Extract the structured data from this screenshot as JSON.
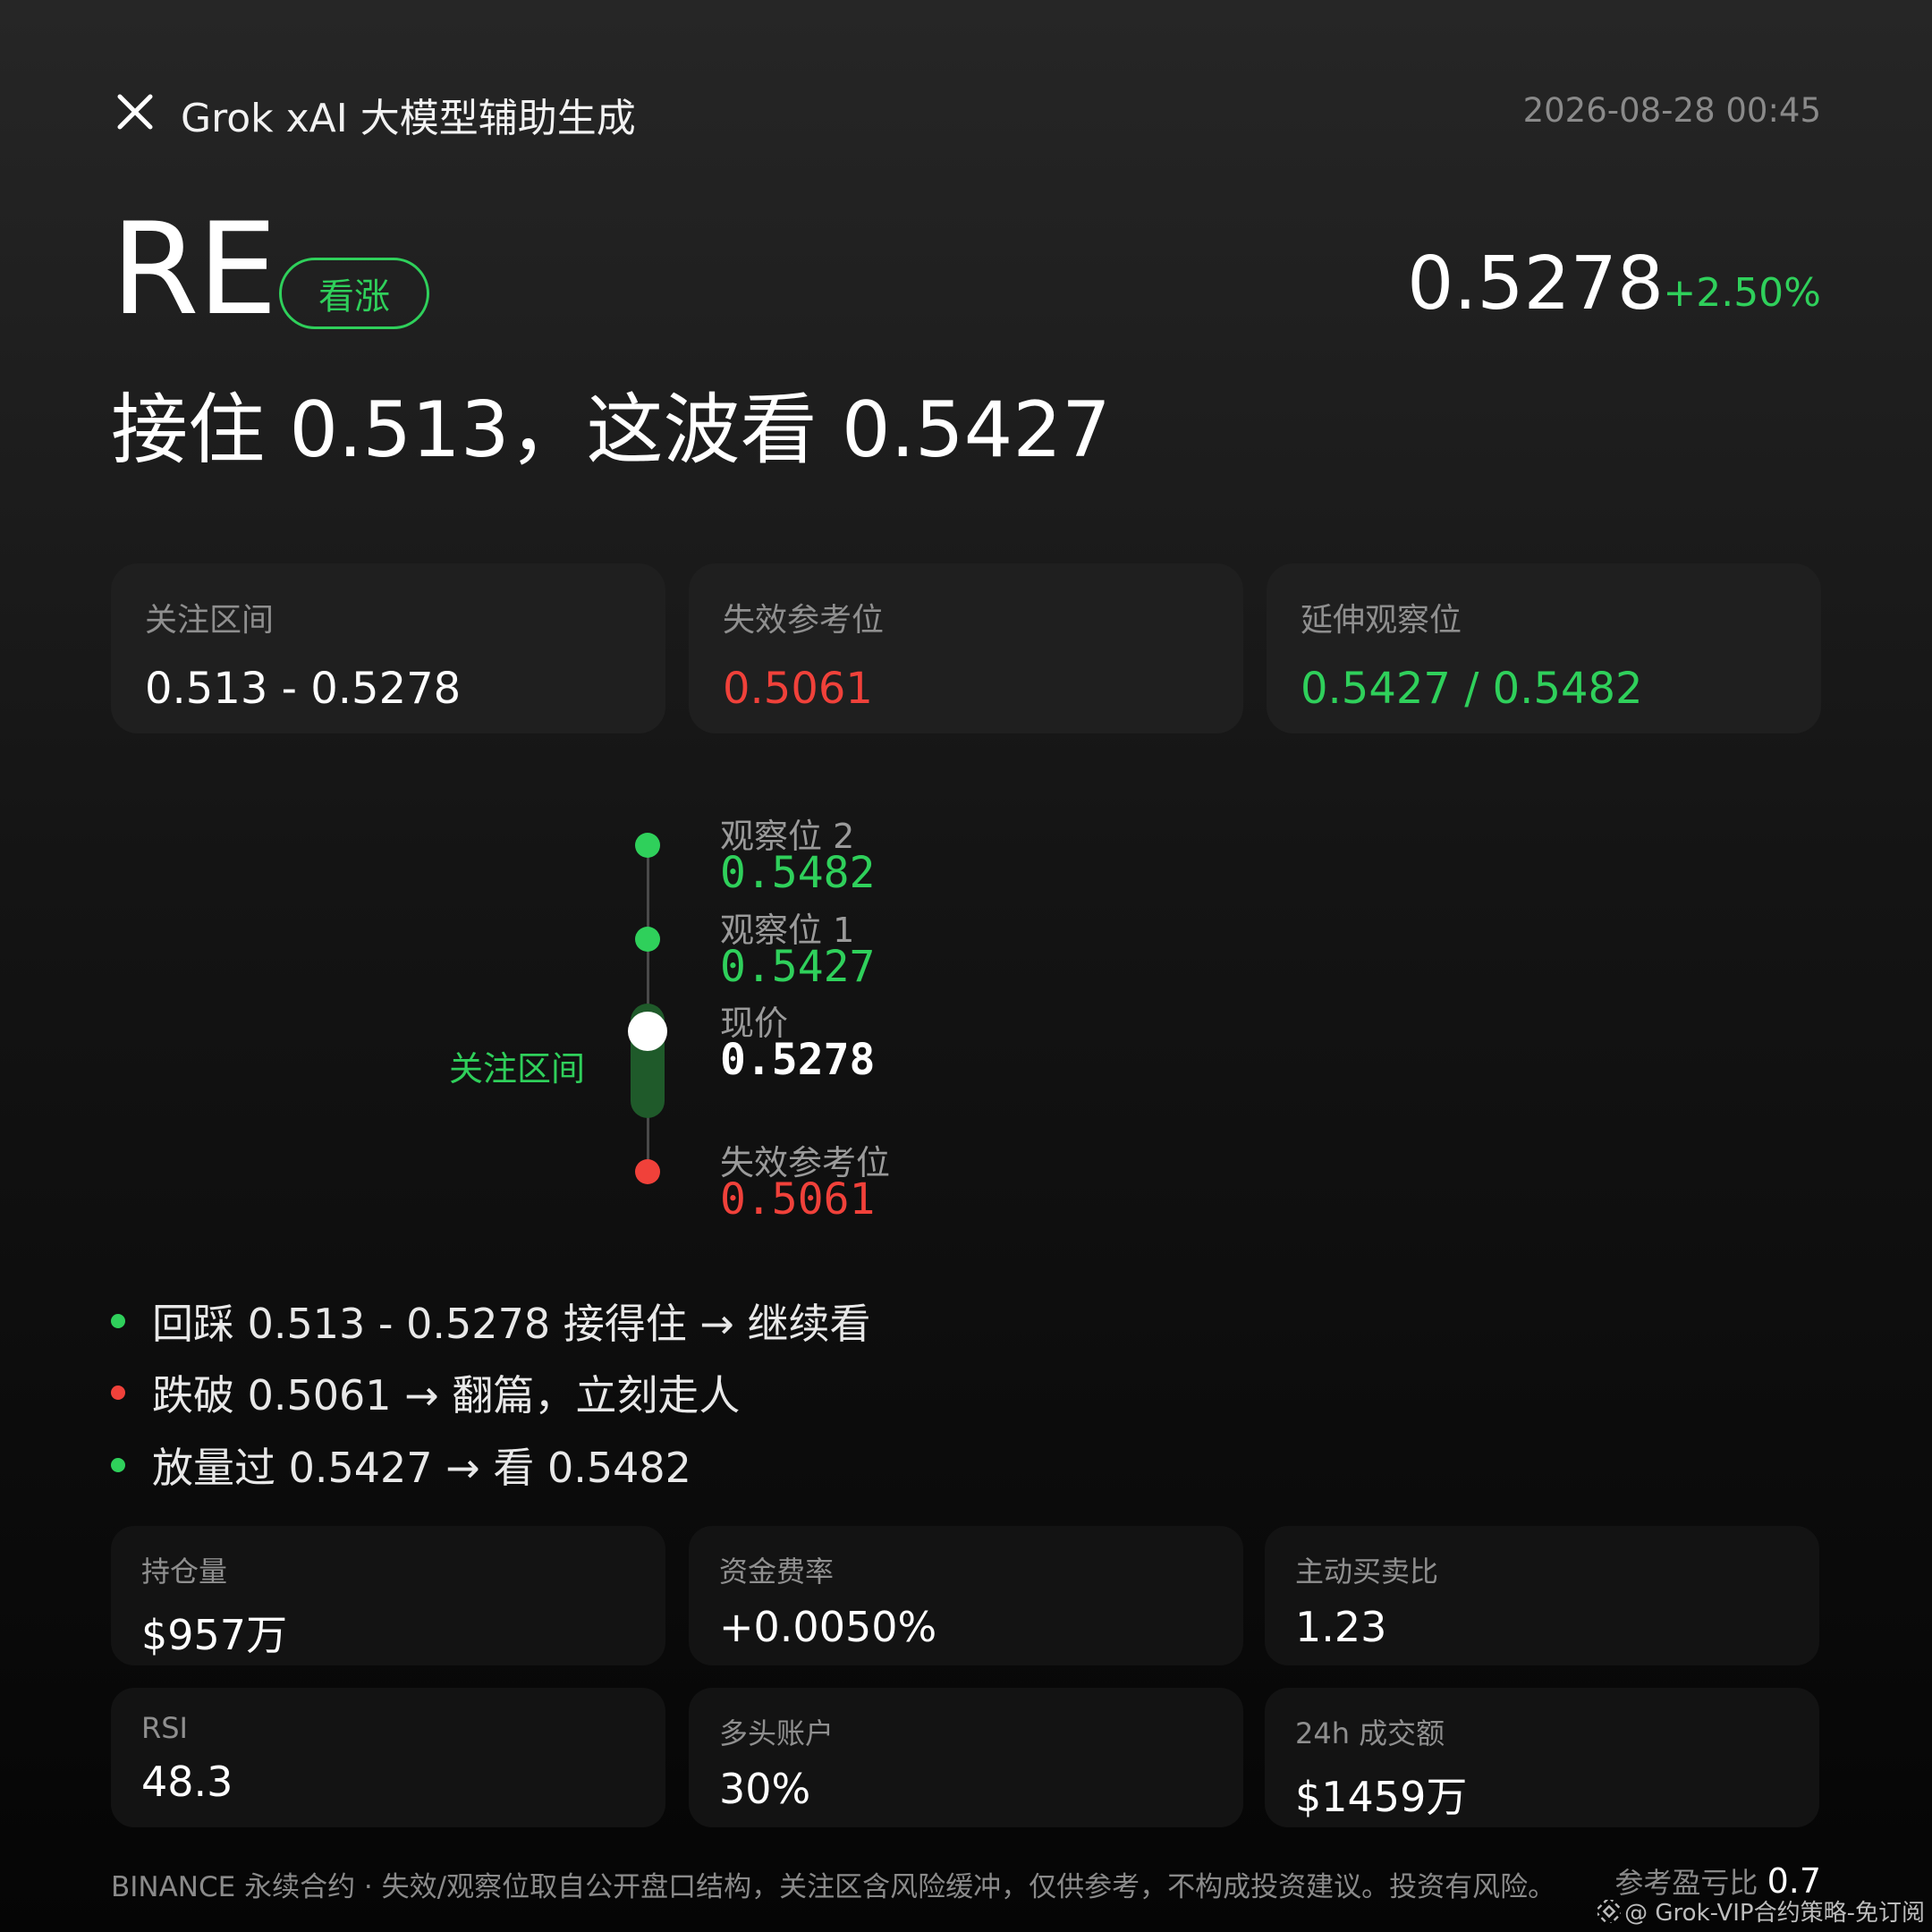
{
  "header": {
    "title": "Grok xAI 大模型辅助生成",
    "timestamp": "2026-08-28 00:45"
  },
  "symbol": "RE",
  "badge": "看涨",
  "price": "0.5278",
  "change": "+2.50%",
  "headline": "接住 0.513，这波看 0.5427",
  "cards": [
    {
      "label": "关注区间",
      "value": "0.513 - 0.5278"
    },
    {
      "label": "失效参考位",
      "value": "0.5061"
    },
    {
      "label": "延伸观察位",
      "value": "0.5427 / 0.5482"
    }
  ],
  "ladder": {
    "zone_label": "关注区间",
    "levels": [
      {
        "label": "观察位 2",
        "value": "0.5482"
      },
      {
        "label": "观察位 1",
        "value": "0.5427"
      },
      {
        "label": "现价",
        "value": "0.5278"
      },
      {
        "label": "失效参考位",
        "value": "0.5061"
      }
    ]
  },
  "bullets": [
    {
      "text": "回踩 0.513 - 0.5278 接得住 → 继续看"
    },
    {
      "text": "跌破 0.5061 → 翻篇，立刻走人"
    },
    {
      "text": "放量过 0.5427 → 看 0.5482"
    }
  ],
  "stats": [
    {
      "label": "持仓量",
      "value": "$957万"
    },
    {
      "label": "资金费率",
      "value": "+0.0050%"
    },
    {
      "label": "主动买卖比",
      "value": "1.23"
    },
    {
      "label": "RSI",
      "value": "48.3"
    },
    {
      "label": "多头账户",
      "value": "30%"
    },
    {
      "label": "24h 成交额",
      "value": "$1459万"
    }
  ],
  "footer": {
    "disclaimer": "BINANCE 永续合约 · 失效/观察位取自公开盘口结构，关注区含风险缓冲，仅供参考，不构成投资建议。投资有风险。",
    "rr_label": "参考盈亏比",
    "rr_value": "0.7",
    "watermark": "@ Grok-VIP合约策略-免订阅"
  },
  "colors": {
    "up": "#2fd05b",
    "down": "#f0413a",
    "background": "#141414"
  },
  "icons": {
    "close": "close-icon",
    "watermark": "binance-logo-icon"
  }
}
